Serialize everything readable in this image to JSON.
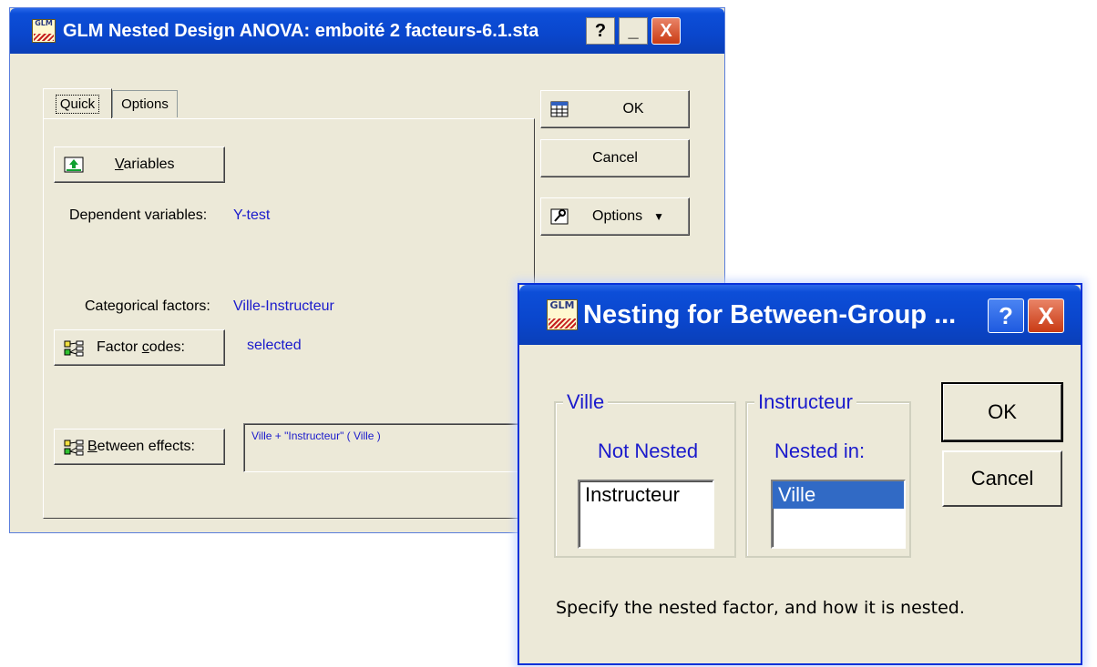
{
  "main_dialog": {
    "title": "GLM Nested Design ANOVA: emboité 2 facteurs-6.1.sta",
    "icon_text": "GLM",
    "tabs": [
      {
        "label": "Quick",
        "active": true
      },
      {
        "label": "Options",
        "active": false
      }
    ],
    "variables_button": {
      "mnemonic": "V",
      "rest": "ariables"
    },
    "dependent_label": "Dependent variables:",
    "dependent_value": "Y-test",
    "categorical_label": "Categorical factors:",
    "categorical_value": "Ville-Instructeur",
    "factor_codes_button": {
      "pre": "Factor ",
      "mnemonic": "c",
      "rest": "odes:"
    },
    "factor_codes_value": "selected",
    "between_effects_button": {
      "mnemonic": "B",
      "rest": "etween effects:"
    },
    "between_effects_value": "Ville + \"Instructeur\" ( Ville )",
    "ok_label": "OK",
    "cancel_label": "Cancel",
    "options_label": "Options",
    "title_buttons": {
      "help": "?",
      "minimize": "_",
      "close": "X"
    }
  },
  "nesting_dialog": {
    "title": "Nesting for Between-Group ...",
    "icon_text": "GLM",
    "group_ville": {
      "legend": "Ville",
      "status": "Not Nested",
      "items": [
        "Instructeur"
      ]
    },
    "group_instructeur": {
      "legend": "Instructeur",
      "status": "Nested in:",
      "items": [
        "Ville"
      ],
      "selected_item": "Ville"
    },
    "ok_label": "OK",
    "cancel_label": "Cancel",
    "footer_text": "Specify the nested factor, and how it is nested.",
    "title_buttons": {
      "help": "?",
      "close": "X"
    }
  },
  "colors": {
    "titlebar": "#0a46cc",
    "dialog_bg": "#ece9d8",
    "value_text": "#1a1acc",
    "selection": "#316ac5"
  }
}
